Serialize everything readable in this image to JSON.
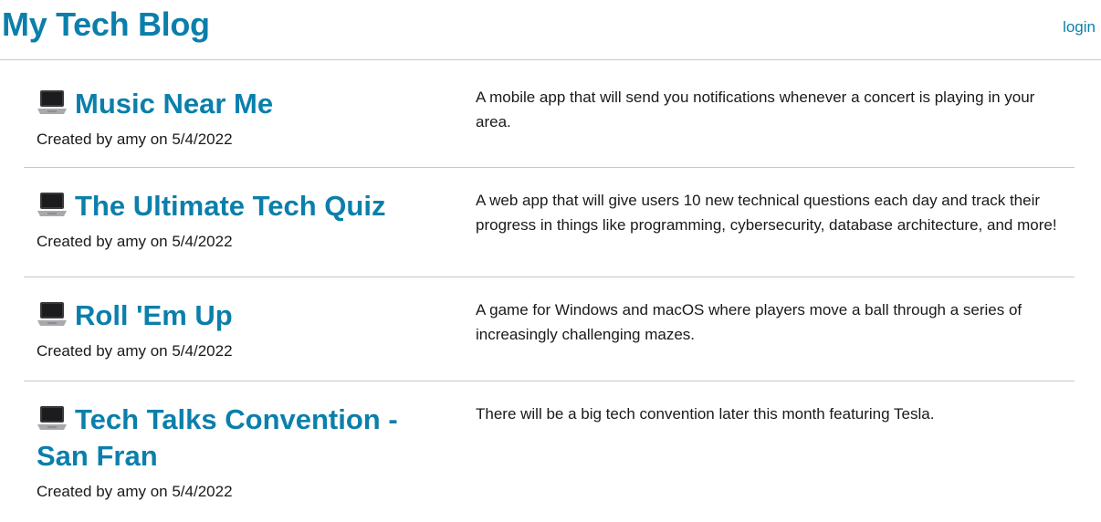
{
  "header": {
    "title": "My Tech Blog",
    "login_label": "login"
  },
  "posts": [
    {
      "icon": "laptop-icon",
      "title": "Music Near Me",
      "meta": "Created by amy on 5/4/2022",
      "description": "A mobile app that will send you notifications whenever a concert is playing in your area."
    },
    {
      "icon": "laptop-icon",
      "title": "The Ultimate Tech Quiz",
      "meta": "Created by amy on 5/4/2022",
      "description": "A web app that will give users 10 new technical questions each day and track their progress in things like programming, cybersecurity, database architecture, and more!"
    },
    {
      "icon": "laptop-icon",
      "title": "Roll 'Em Up",
      "meta": "Created by amy on 5/4/2022",
      "description": "A game for Windows and macOS where players move a ball through a series of increasingly challenging mazes."
    },
    {
      "icon": "laptop-icon",
      "title": "Tech Talks Convention - San Fran",
      "meta": "Created by amy on 5/4/2022",
      "description": "There will be a big tech convention later this month featuring Tesla."
    }
  ]
}
